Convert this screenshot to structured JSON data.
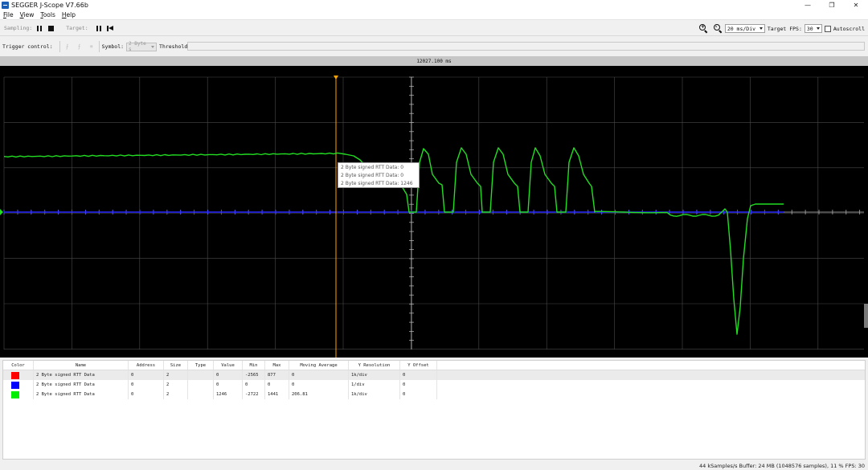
{
  "window": {
    "title": "SEGGER J-Scope V7.66b",
    "controls": [
      "—",
      "❐",
      "✕"
    ]
  },
  "menu": [
    {
      "label": "File",
      "mnemonic": "F",
      "rest": "ile"
    },
    {
      "label": "View",
      "mnemonic": "V",
      "rest": "iew"
    },
    {
      "label": "Tools",
      "mnemonic": "T",
      "rest": "ools"
    },
    {
      "label": "Help",
      "mnemonic": "H",
      "rest": "elp"
    }
  ],
  "toolbar": {
    "sampling_label": "Sampling:",
    "target_label": "Target:",
    "time_div": "20 ms/Div",
    "fps_label": "Target FPS:",
    "fps_value": "30",
    "autoscroll_label": "Autoscroll",
    "autoscroll_checked": false
  },
  "trigger": {
    "label": "Trigger control:",
    "symbol_label": "Symbol:",
    "symbol_value": "2 Byte s",
    "threshold_label": "Threshold:",
    "threshold_value": ""
  },
  "timestamp": "12027.100 ms",
  "tooltip": [
    "2 Byte signed RTT Data: 0",
    "2 Byte signed RTT Data: 0",
    "2 Byte signed RTT Data: 1246"
  ],
  "table": {
    "headers": [
      "Color",
      "Name",
      "Address",
      "Size",
      "Type",
      "Value",
      "Min",
      "Max",
      "Moving Average",
      "Y Resolution",
      "Y Offset"
    ],
    "rows": [
      {
        "color": "#ff0000",
        "name": "2 Byte signed RTT Data",
        "address": "0",
        "size": "2",
        "type": "",
        "value": "0",
        "min": "-2565",
        "max": "877",
        "avg": "0",
        "yres": "1k/div",
        "yoff": "0"
      },
      {
        "color": "#0000ff",
        "name": "2 Byte signed RTT Data",
        "address": "0",
        "size": "2",
        "type": "",
        "value": "0",
        "min": "0",
        "max": "0",
        "avg": "0",
        "yres": "1/div",
        "yoff": "0"
      },
      {
        "color": "#00ee00",
        "name": "2 Byte signed RTT Data",
        "address": "0",
        "size": "2",
        "type": "",
        "value": "1246",
        "min": "-2722",
        "max": "1441",
        "avg": "206.81",
        "yres": "1k/div",
        "yoff": "0"
      }
    ]
  },
  "status": "44 kSamples/s  Buffer: 24 MB (1048576 samples), 11 %  FPS: 30",
  "colors": {
    "trace_green": "#22dd22",
    "trace_blue": "#2222ff",
    "cursor": "#ffa500",
    "grid": "#4a4a4a"
  }
}
